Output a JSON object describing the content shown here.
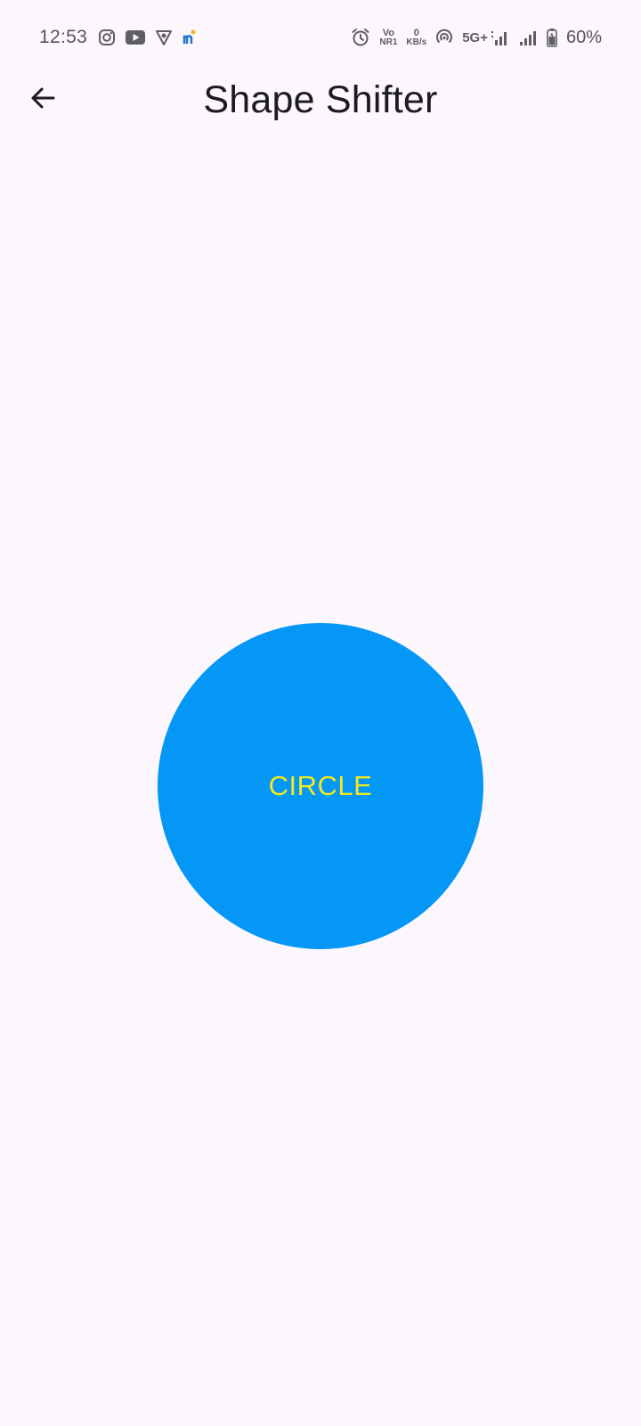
{
  "status_bar": {
    "time": "12:53",
    "left_icons": [
      "instagram-icon",
      "youtube-icon",
      "vpn-shield-icon",
      "mi-app-icon"
    ],
    "volte_top": "Vo",
    "volte_bottom": "NR1",
    "speed_value": "0",
    "speed_unit": "KB/s",
    "network_type": "5G+",
    "battery_percent": "60%"
  },
  "app_bar": {
    "title": "Shape Shifter",
    "back_icon": "arrow-back-icon"
  },
  "shape": {
    "label": "CIRCLE",
    "type": "circle",
    "fill_color": "#0497f6",
    "text_color": "#f4e81f"
  },
  "colors": {
    "background": "#fcf6fd",
    "title": "#1c1b1f"
  }
}
